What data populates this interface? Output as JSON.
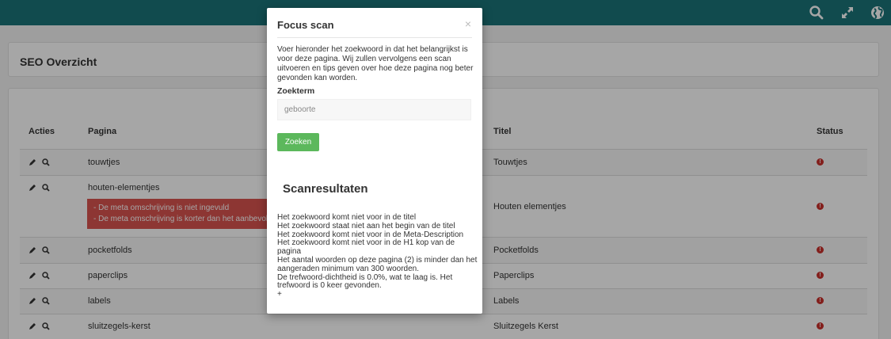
{
  "colors": {
    "topbar": "#1b7378",
    "error_box": "#d9534f",
    "status_error": "#c9302c",
    "button": "#5cb85c"
  },
  "topbar": {
    "icons": [
      "search-icon",
      "expand-icon",
      "globe-icon"
    ]
  },
  "page": {
    "title": "SEO Overzicht",
    "table": {
      "headers": {
        "acties": "Acties",
        "pagina": "Pagina",
        "titel": "Titel",
        "status": "Status"
      },
      "rows": [
        {
          "pagina": "touwtjes",
          "titel": "Touwtjes",
          "status": "error"
        },
        {
          "pagina": "houten-elementjes",
          "titel": "Houten elementjes",
          "status": "error",
          "errors": [
            "- De meta omschrijving is niet ingevuld",
            "- De meta omschrijving is korter dan het aanbevolen"
          ]
        },
        {
          "pagina": "pocketfolds",
          "titel": "Pocketfolds",
          "status": "error"
        },
        {
          "pagina": "paperclips",
          "titel": "Paperclips",
          "status": "error"
        },
        {
          "pagina": "labels",
          "titel": "Labels",
          "status": "error"
        },
        {
          "pagina": "sluitzegels-kerst",
          "titel": "Sluitzegels Kerst",
          "status": "error"
        }
      ]
    }
  },
  "modal": {
    "title": "Focus scan",
    "close": "×",
    "intro": "Voer hieronder het zoekwoord in dat het belangrijkst is voor deze pagina. Wij zullen vervolgens een scan uitvoeren en tips geven over hoe deze pagina nog beter gevonden kan worden.",
    "field_label": "Zoekterm",
    "field_value": "geboorte",
    "button": "Zoeken",
    "results_title": "Scanresultaten",
    "results": [
      "Het zoekwoord komt niet voor in de titel",
      "Het zoekwoord staat niet aan het begin van de titel",
      "Het zoekwoord komt niet voor in de Meta-Description",
      "Het zoekwoord komt niet voor in de H1 kop van de pagina",
      "Het aantal woorden op deze pagina (2) is minder dan het aangeraden minimum van 300 woorden.",
      "De trefwoord-dichtheid is 0.0%, wat te laag is. Het trefwoord is 0 keer gevonden.",
      "+"
    ]
  }
}
